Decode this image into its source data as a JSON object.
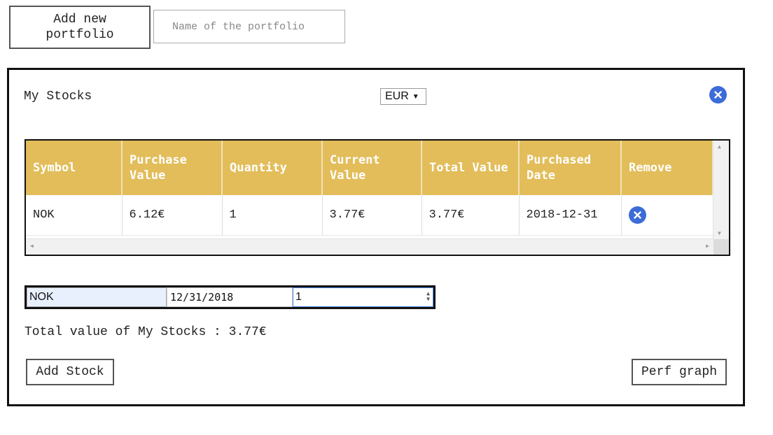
{
  "top": {
    "add_portfolio_label": "Add new portfolio",
    "portfolio_name_placeholder": "Name of the portfolio"
  },
  "portfolio": {
    "title": "My Stocks",
    "currency": "EUR",
    "close_icon": "close-icon",
    "table": {
      "headers": [
        "Symbol",
        "Purchase Value",
        "Quantity",
        "Current Value",
        "Total Value",
        "Purchased Date",
        "Remove"
      ],
      "rows": [
        {
          "symbol": "NOK",
          "purchase_value": "6.12€",
          "quantity": "1",
          "current_value": "3.77€",
          "total_value": "3.77€",
          "purchased_date": "2018-12-31",
          "remove_icon": "close-icon"
        }
      ]
    },
    "form": {
      "symbol_value": "NOK",
      "date_value": "12/31/2018",
      "quantity_value": "1"
    },
    "total_line": "Total value of My Stocks : 3.77€",
    "add_stock_label": "Add Stock",
    "perf_graph_label": "Perf graph"
  },
  "colors": {
    "header_bg": "#e2bd5a",
    "icon_blue": "#3c6cd8"
  }
}
